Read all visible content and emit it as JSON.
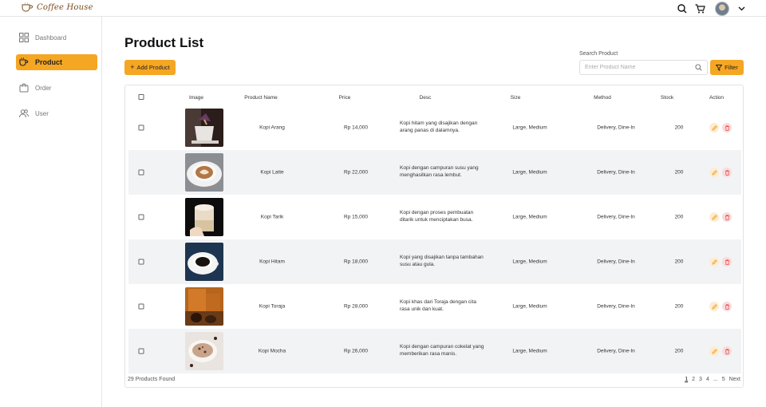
{
  "brand": {
    "logo_text": "Coffee House"
  },
  "sidebar": {
    "items": [
      {
        "label": "Dashboard",
        "icon": "grid-icon"
      },
      {
        "label": "Product",
        "icon": "cup-icon",
        "active": true
      },
      {
        "label": "Order",
        "icon": "bag-icon"
      },
      {
        "label": "User",
        "icon": "users-icon"
      }
    ]
  },
  "main": {
    "title": "Product List",
    "add_button": "Add Product",
    "search_label": "Search Product",
    "search_placeholder": "Enter Product Name",
    "filter_button": "Filter"
  },
  "table": {
    "headers": [
      "Image",
      "Product Name",
      "Price",
      "Desc",
      "Size",
      "Method",
      "Stock",
      "Action"
    ],
    "rows": [
      {
        "name": "Kopi Arang",
        "price": "Rp 14,000",
        "desc": "Kopi hitam yang disajikan dengan arang panas di dalamnya.",
        "size": "Large, Medium",
        "method": "Delivery, Dine-In",
        "stock": "200"
      },
      {
        "name": "Kopi Latte",
        "price": "Rp 22,000",
        "desc": "Kopi dengan campuran susu yang menghasilkan rasa lembut.",
        "size": "Large, Medium",
        "method": "Delivery, Dine-In",
        "stock": "200"
      },
      {
        "name": "Kopi Tarik",
        "price": "Rp 15,000",
        "desc": "Kopi dengan proses pembuatan ditarik untuk menciptakan busa.",
        "size": "Large, Medium",
        "method": "Delivery, Dine-In",
        "stock": "200"
      },
      {
        "name": "Kopi Hitam",
        "price": "Rp 18,000",
        "desc": "Kopi yang disajikan tanpa tambahan susu atau gula.",
        "size": "Large, Medium",
        "method": "Delivery, Dine-In",
        "stock": "200"
      },
      {
        "name": "Kopi Toraja",
        "price": "Rp 28,000",
        "desc": "Kopi khas dari Toraja dengan cita rasa unik dan kuat.",
        "size": "Large, Medium",
        "method": "Delivery, Dine-In",
        "stock": "200"
      },
      {
        "name": "Kopi Mocha",
        "price": "Rp 26,000",
        "desc": "Kopi dengan campuran cokelat yang memberikan rasa manis.",
        "size": "Large, Medium",
        "method": "Delivery, Dine-In",
        "stock": "200"
      }
    ]
  },
  "footer": {
    "count_text": "29 Products Found",
    "pages": [
      "1",
      "2",
      "3",
      "4",
      "...",
      "5",
      "Next"
    ],
    "current_page": "1"
  },
  "colors": {
    "accent": "#f5a623",
    "row_alt": "#f2f3f5",
    "edit_icon": "#f5a623",
    "delete_icon": "#e05555"
  }
}
